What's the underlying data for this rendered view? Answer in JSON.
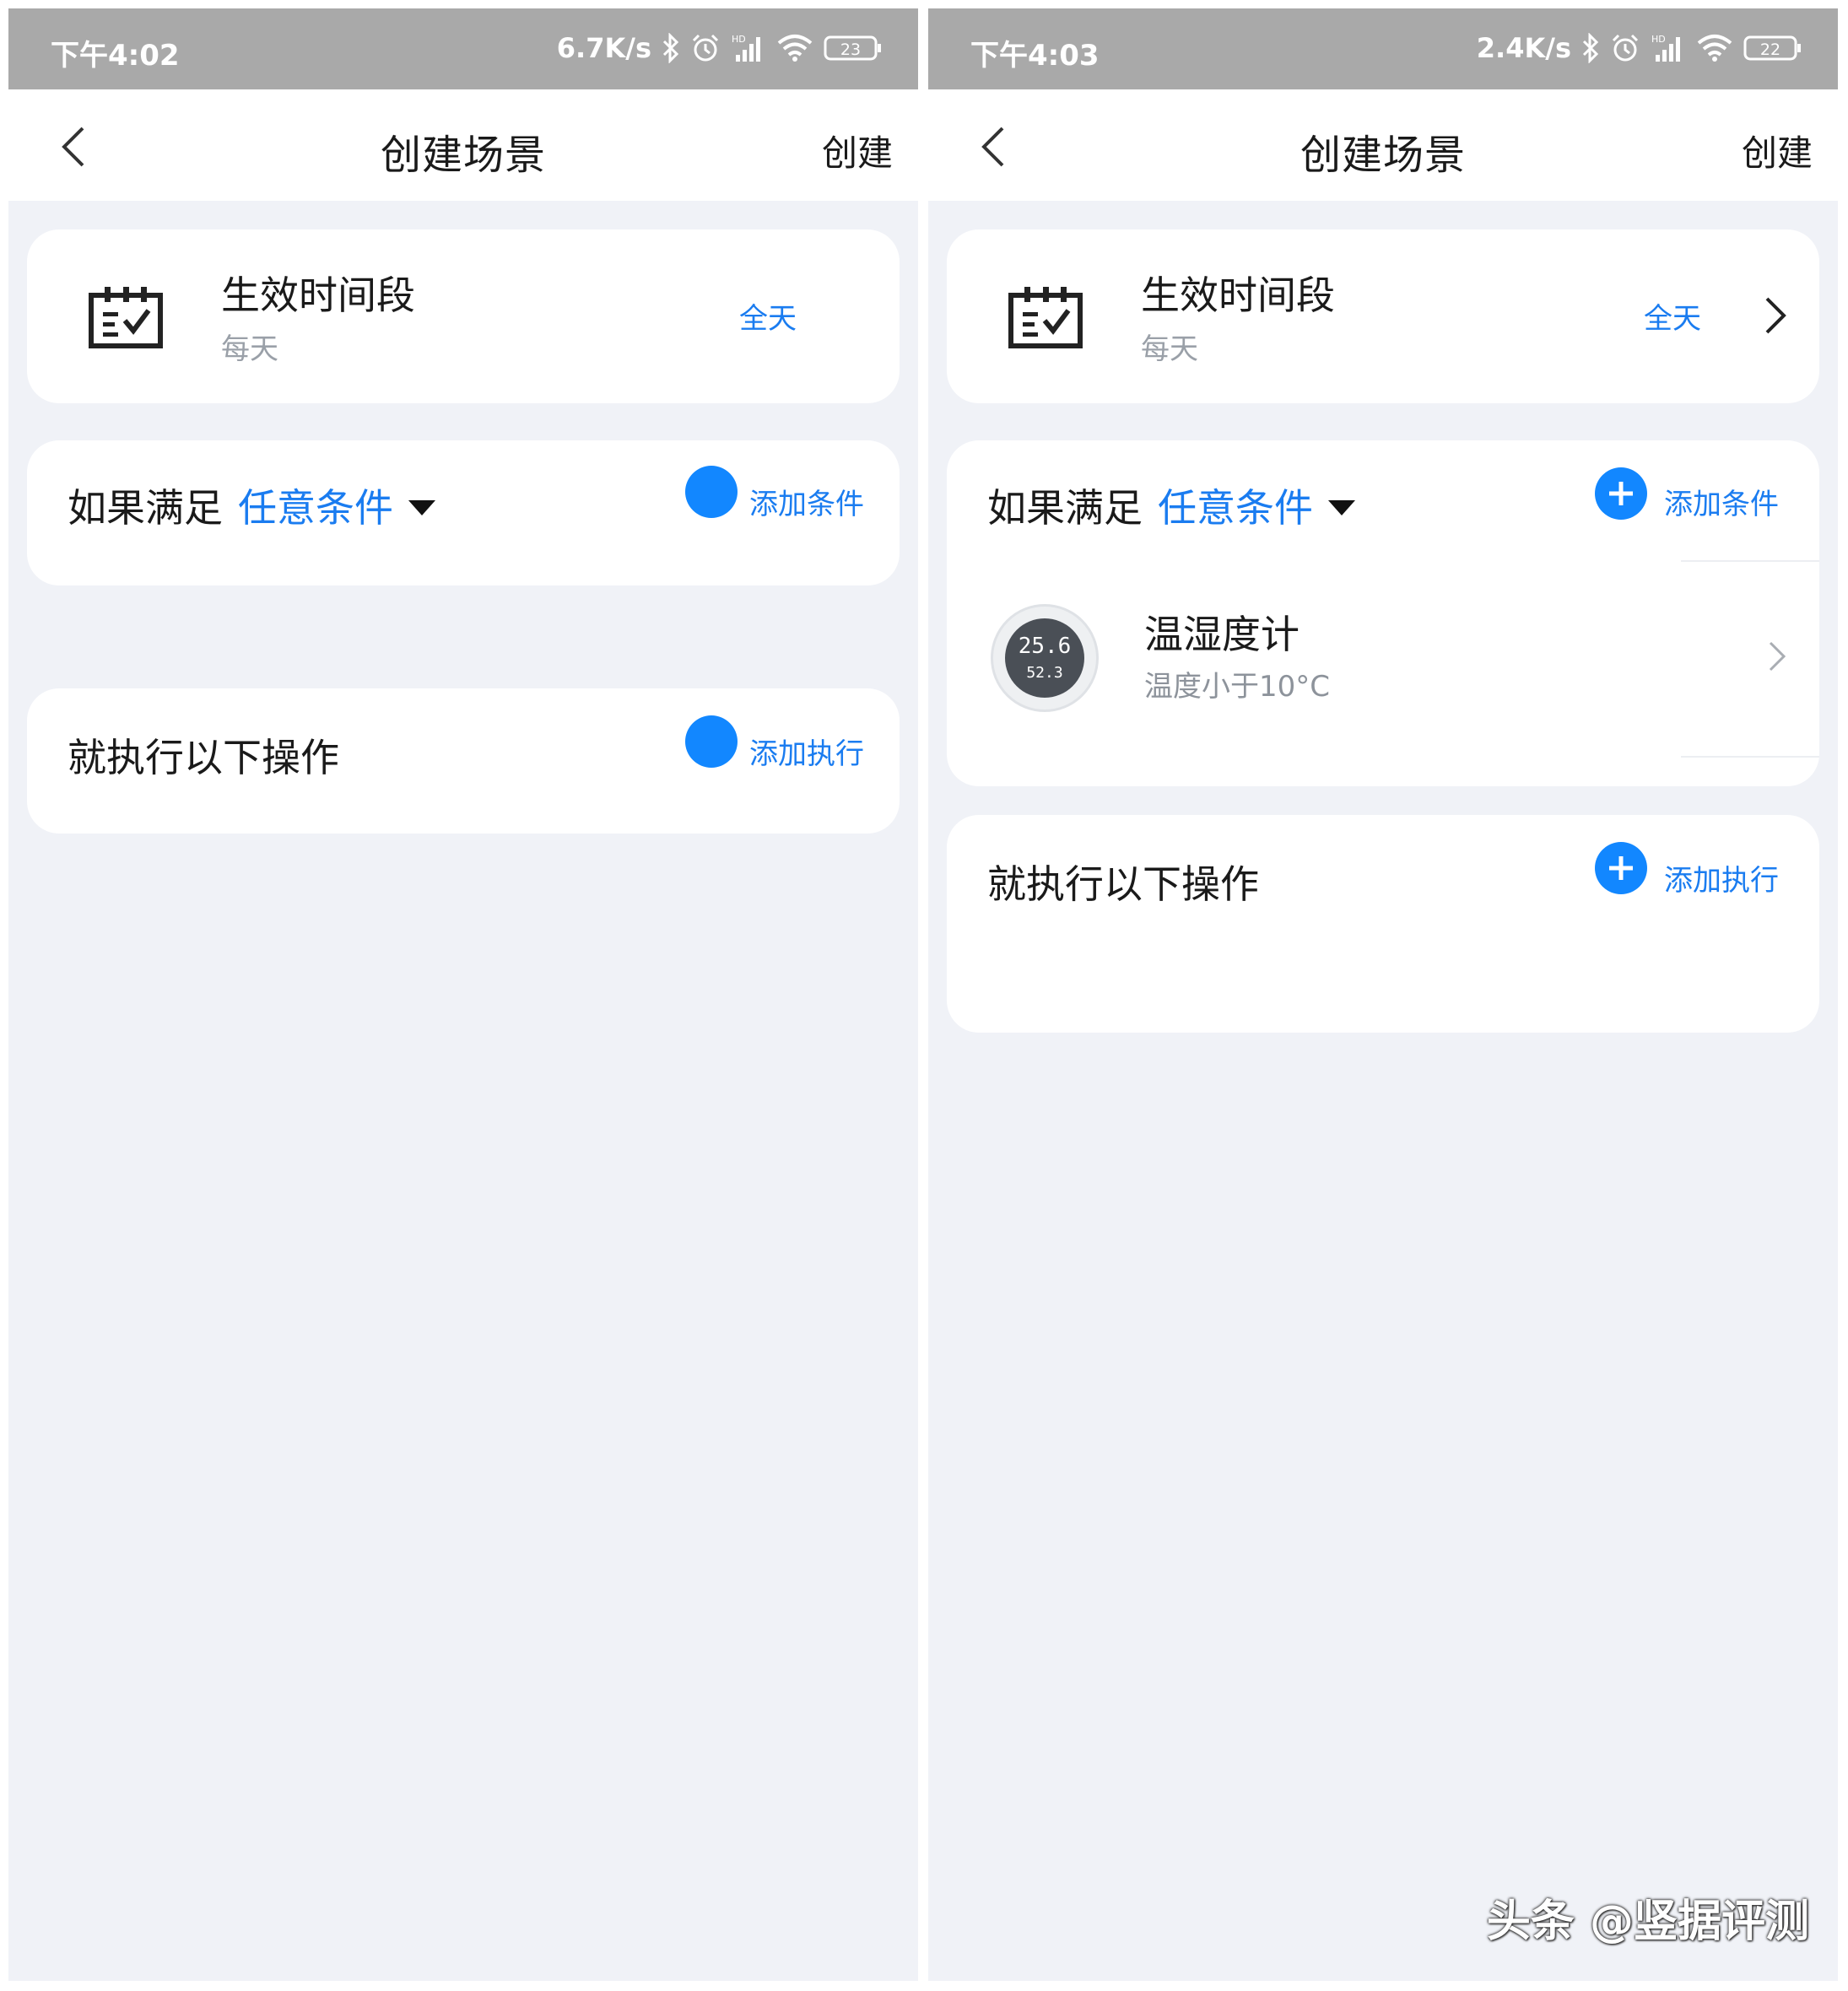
{
  "screens": [
    {
      "status_bar": {
        "time": "下午4:02",
        "net_speed": "6.7K/s",
        "battery": "23",
        "icons": [
          "bluetooth-icon",
          "alarm-icon",
          "signal-hd-icon",
          "wifi-icon",
          "battery-icon"
        ]
      },
      "nav": {
        "title": "创建场景",
        "action": "创建",
        "back_icon": "chevron-left-icon"
      },
      "time_card": {
        "title": "生效时间段",
        "subtitle": "每天",
        "value": "全天",
        "icon": "calendar-check-icon"
      },
      "condition_card": {
        "prefix": "如果满足",
        "type": "任意条件",
        "add_label": "添加条件"
      },
      "action_card": {
        "title": "就执行以下操作",
        "add_label": "添加执行"
      }
    },
    {
      "status_bar": {
        "time": "下午4:03",
        "net_speed": "2.4K/s",
        "battery": "22",
        "icons": [
          "bluetooth-icon",
          "alarm-icon",
          "signal-hd-icon",
          "wifi-icon",
          "battery-icon"
        ]
      },
      "nav": {
        "title": "创建场景",
        "action": "创建",
        "back_icon": "chevron-left-icon"
      },
      "time_card": {
        "title": "生效时间段",
        "subtitle": "每天",
        "value": "全天",
        "icon": "calendar-check-icon"
      },
      "condition_card": {
        "prefix": "如果满足",
        "type": "任意条件",
        "add_label": "添加条件",
        "device": {
          "name": "温湿度计",
          "condition": "温度小于10°C",
          "display_temp": "25.6",
          "display_humidity": "52.3"
        }
      },
      "action_card": {
        "title": "就执行以下操作",
        "add_label": "添加执行"
      }
    }
  ],
  "watermark": "头条 @竖据评测",
  "colors": {
    "accent": "#1a7cf0",
    "add_button": "#1287ff",
    "status_bar": "#a9a9a9",
    "background": "#f0f2f7"
  }
}
